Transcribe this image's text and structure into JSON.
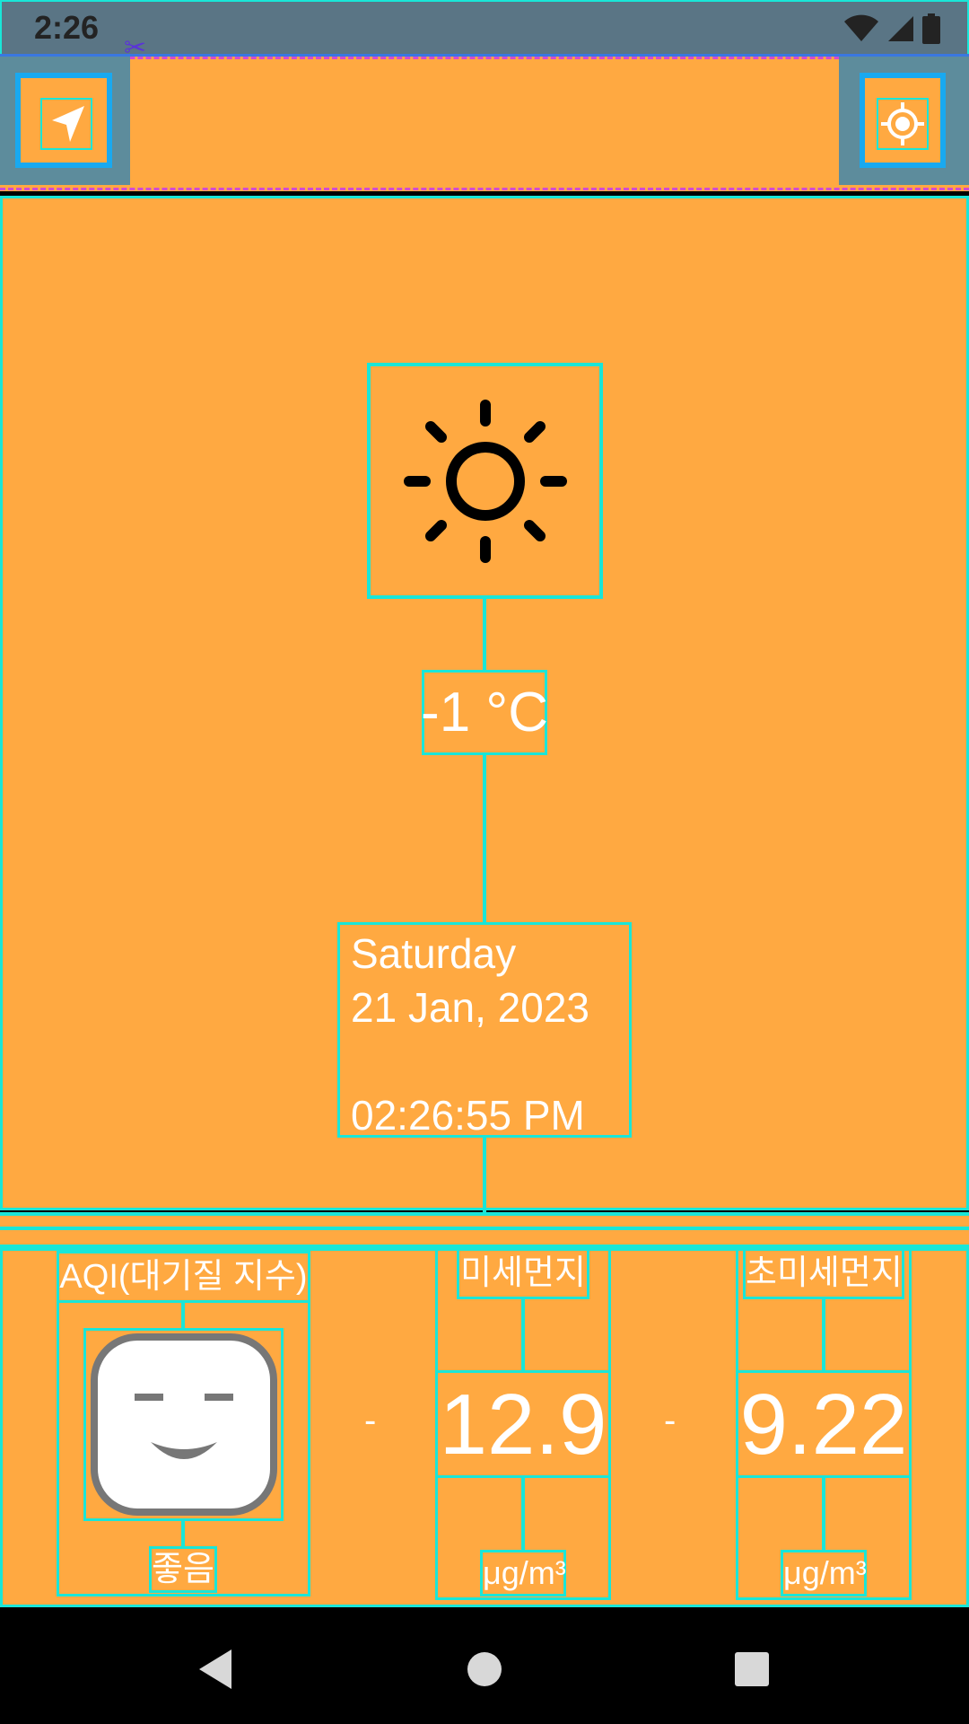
{
  "status_bar": {
    "time": "2:26",
    "icons": [
      "wifi-icon",
      "cellular-signal-icon",
      "battery-icon"
    ]
  },
  "app_bar": {
    "left_button_icon": "navigation-arrow-icon",
    "right_button_icon": "my-location-icon"
  },
  "weather": {
    "condition_icon": "sun-icon",
    "temperature": "-1 °C",
    "day": "Saturday",
    "date": "21 Jan, 2023",
    "time": "02:26:55 PM"
  },
  "air_quality": {
    "aqi": {
      "label": "AQI(대기질 지수)",
      "face_icon": "smiling-face-icon",
      "status": "좋음"
    },
    "separator_1": "-",
    "pm10": {
      "label": "미세먼지",
      "value": "12.9",
      "unit": "μg/m³"
    },
    "separator_2": "-",
    "pm25": {
      "label": "초미세먼지",
      "value": "9.22",
      "unit": "μg/m³"
    }
  },
  "nav_bar": {
    "icons": [
      "back-icon",
      "home-icon",
      "recents-icon"
    ]
  },
  "colors": {
    "background": "#ffa941",
    "status_bar": "#5a7585",
    "layout_outline": "#19e6d8",
    "button_frame": "#19a9f0"
  }
}
